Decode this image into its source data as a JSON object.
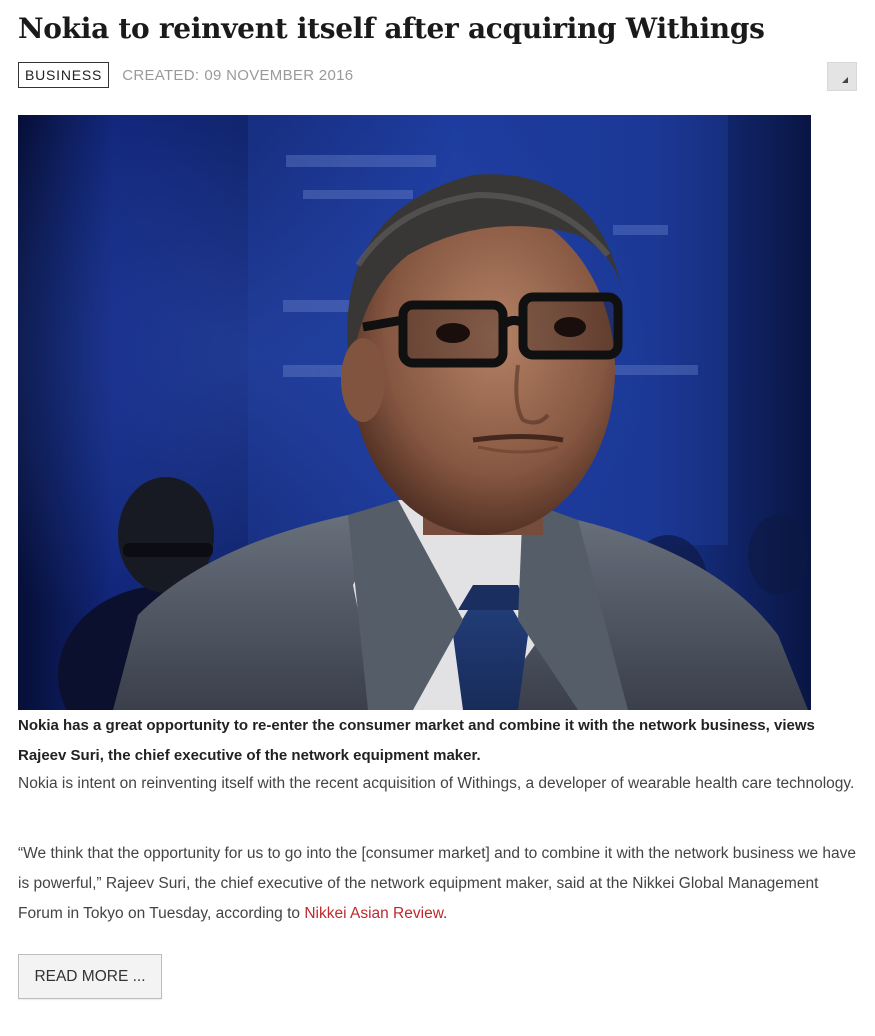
{
  "article": {
    "title": "Nokia to reinvent itself after acquiring Withings",
    "category": "BUSINESS",
    "created_label": "CREATED:",
    "created_date": "09 NOVEMBER 2016",
    "image_caption": "Nokia has a great opportunity to re-enter the consumer market and combine it with the network business, views Rajeev Suri, the chief executive of the network equipment maker.",
    "paragraph_1": "Nokia is intent on reinventing itself with the recent acquisition of Withings, a developer of wearable health care technology.",
    "paragraph_2_text": "“We think that the opportunity for us to go into the [consumer market] and to combine it with the network business we have is powerful,” Rajeev Suri, the chief executive of the network equipment maker, said at the Nikkei Global Management Forum in Tokyo on Tuesday, according to ",
    "paragraph_2_link": "Nikkei Asian Review",
    "paragraph_2_end": ".",
    "read_more_label": "READ MORE ..."
  },
  "icons": {
    "resize": "resize-corner-icon"
  },
  "colors": {
    "link": "#c0282d",
    "meta_text": "#9a9a9a",
    "photo_backdrop": "#1b3a9e"
  }
}
